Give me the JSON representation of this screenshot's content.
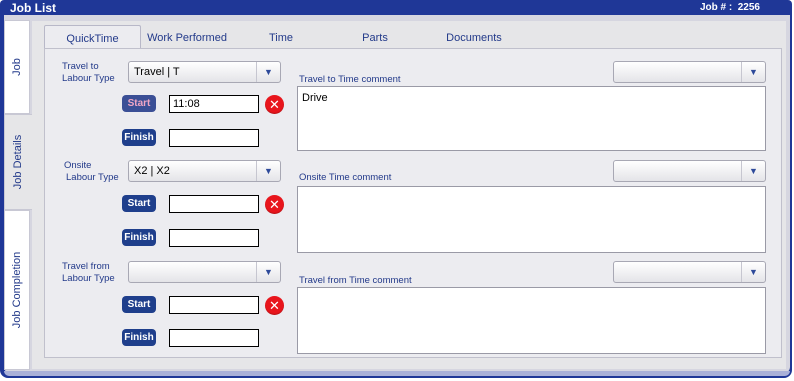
{
  "window": {
    "title": "Job List",
    "job_number_label": "Job # :",
    "job_number": "2256"
  },
  "side_tabs": [
    {
      "label": "Job"
    },
    {
      "label": "Job Details"
    },
    {
      "label": "Job Completion"
    }
  ],
  "tabs": [
    {
      "label": "QuickTime"
    },
    {
      "label": "Work Performed"
    },
    {
      "label": "Time"
    },
    {
      "label": "Parts"
    },
    {
      "label": "Documents"
    }
  ],
  "sections": [
    {
      "label_line1": "Travel to",
      "label_line2": "Labour Type",
      "type_value": "Travel | T",
      "start_label": "Start",
      "start_value": "11:08",
      "finish_label": "Finish",
      "finish_value": "",
      "comment_label": "Travel to Time comment",
      "comment_value": "Drive"
    },
    {
      "label_line1": "Onsite",
      "label_line2": "Labour Type",
      "type_value": "X2 | X2",
      "start_label": "Start",
      "start_value": "",
      "finish_label": "Finish",
      "finish_value": "",
      "comment_label": "Onsite Time comment",
      "comment_value": ""
    },
    {
      "label_line1": "Travel from",
      "label_line2": "Labour Type",
      "type_value": "",
      "start_label": "Start",
      "start_value": "",
      "finish_label": "Finish",
      "finish_value": "",
      "comment_label": "Travel from Time comment",
      "comment_value": ""
    }
  ],
  "colors": {
    "brand": "#1f3797",
    "button": "#1f3f8c",
    "clear": "#e8151c"
  },
  "icons": {
    "dropdown": "chevron-down-icon",
    "clear": "close-icon"
  }
}
